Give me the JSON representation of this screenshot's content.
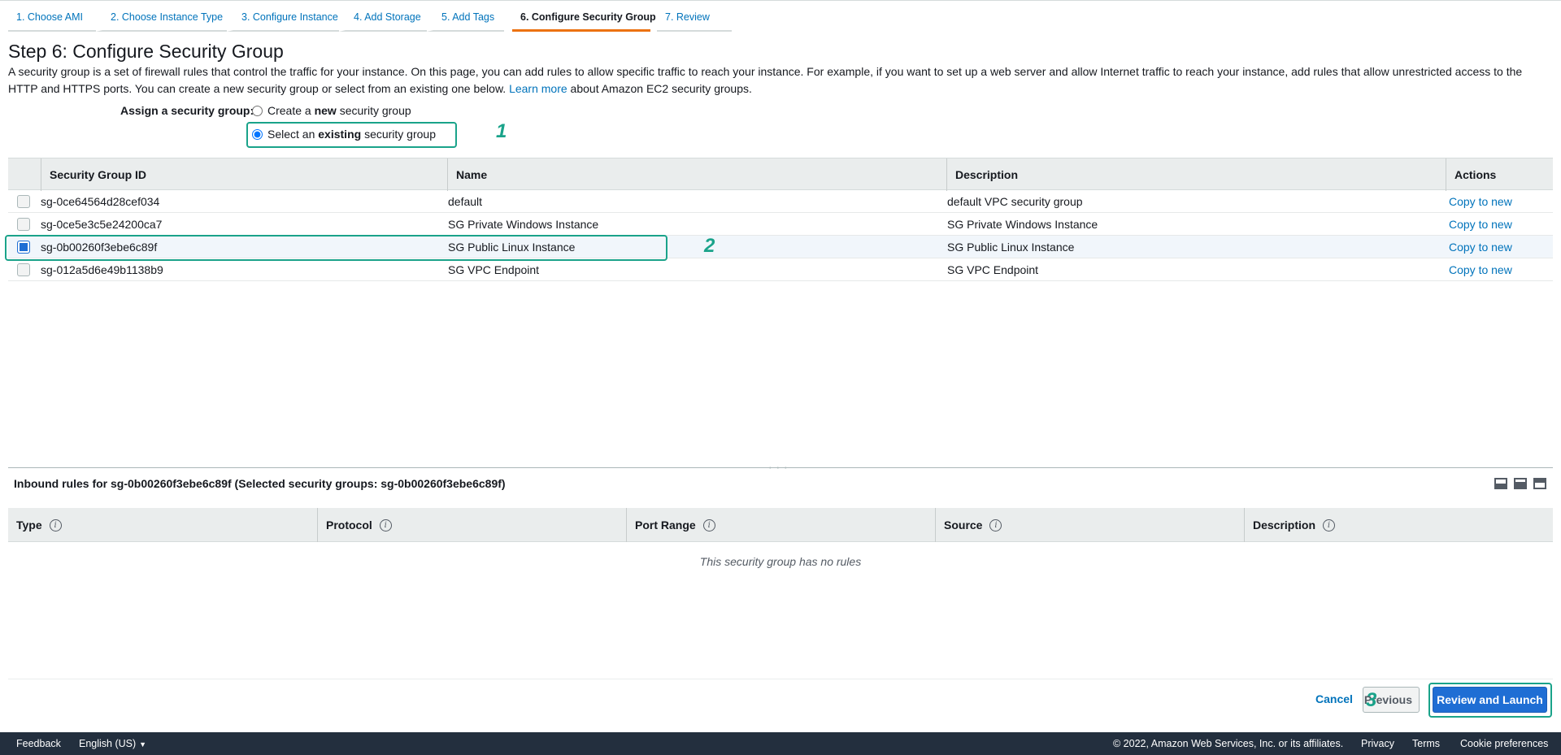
{
  "tabs": [
    {
      "label": "1. Choose AMI"
    },
    {
      "label": "2. Choose Instance Type"
    },
    {
      "label": "3. Configure Instance"
    },
    {
      "label": "4. Add Storage"
    },
    {
      "label": "5. Add Tags"
    },
    {
      "label": "6. Configure Security Group",
      "active": true
    },
    {
      "label": "7. Review"
    }
  ],
  "page": {
    "title": "Step 6: Configure Security Group",
    "intro": "A security group is a set of firewall rules that control the traffic for your instance. On this page, you can add rules to allow specific traffic to reach your instance. For example, if you want to set up a web server and allow Internet traffic to reach your instance, add rules that allow unrestricted access to the HTTP and HTTPS ports. You can create a new security group or select from an existing one below.",
    "learn_more": "Learn more",
    "intro_suffix": "about Amazon EC2 security groups."
  },
  "assign": {
    "label": "Assign a security group:",
    "create_pre": "Create a",
    "create_bold": "new",
    "create_post": "security group",
    "select_pre": "Select an",
    "select_bold": "existing",
    "select_post": "security group",
    "selected": "existing"
  },
  "annotations": {
    "one": "1",
    "two": "2",
    "three": "3"
  },
  "sg_table": {
    "headers": {
      "id": "Security Group ID",
      "name": "Name",
      "description": "Description",
      "actions": "Actions"
    },
    "rows": [
      {
        "id": "sg-0ce64564d28cef034",
        "name": "default",
        "description": "default VPC security group",
        "action": "Copy to new",
        "checked": false
      },
      {
        "id": "sg-0ce5e3c5e24200ca7",
        "name": "SG Private Windows Instance",
        "description": "SG Private Windows Instance",
        "action": "Copy to new",
        "checked": false
      },
      {
        "id": "sg-0b00260f3ebe6c89f",
        "name": "SG Public Linux Instance",
        "description": "SG Public Linux Instance",
        "action": "Copy to new",
        "checked": true
      },
      {
        "id": "sg-012a5d6e49b1138b9",
        "name": "SG VPC Endpoint",
        "description": "SG VPC Endpoint",
        "action": "Copy to new",
        "checked": false
      }
    ]
  },
  "splitter_grip": "˚ ˚ ˚",
  "inbound": {
    "title": "Inbound rules for sg-0b00260f3ebe6c89f (Selected security groups: sg-0b00260f3ebe6c89f)",
    "headers": {
      "type": "Type",
      "protocol": "Protocol",
      "port_range": "Port Range",
      "source": "Source",
      "description": "Description"
    },
    "info_glyph": "i",
    "empty": "This security group has no rules"
  },
  "footer_actions": {
    "cancel": "Cancel",
    "previous": "Previous",
    "review_launch": "Review and Launch"
  },
  "bottom_bar": {
    "feedback": "Feedback",
    "language": "English (US)",
    "caret": "▼",
    "copyright": "© 2022, Amazon Web Services, Inc. or its affiliates.",
    "privacy": "Privacy",
    "terms": "Terms",
    "cookies": "Cookie preferences"
  },
  "colors": {
    "link": "#0073bb",
    "active_tab": "#ec7211",
    "primary_button": "#1f6ed4",
    "annotation": "#1aa38a",
    "bottom_bar": "#232f3e"
  }
}
